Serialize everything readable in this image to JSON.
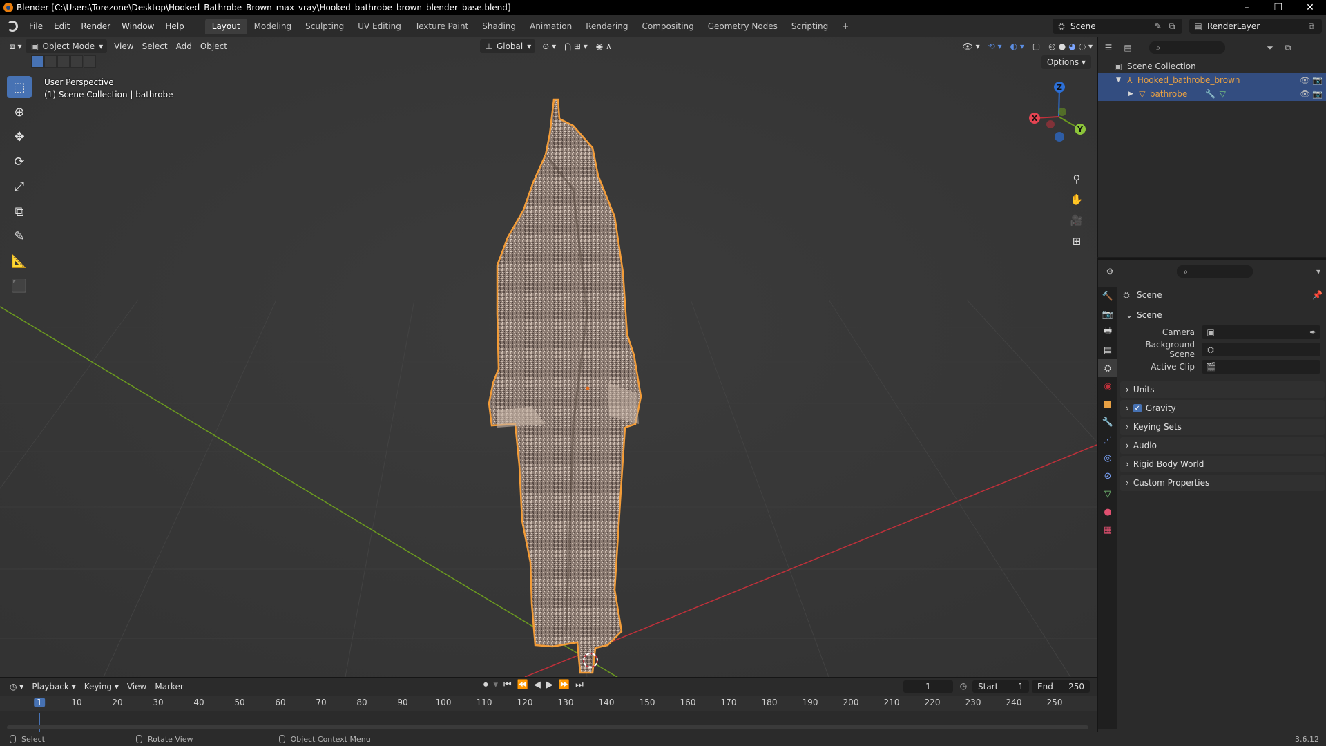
{
  "window": {
    "title": "Blender [C:\\Users\\Torezone\\Desktop\\Hooked_Bathrobe_Brown_max_vray\\Hooked_bathrobe_brown_blender_base.blend]",
    "controls": [
      "–",
      "❐",
      "✕"
    ]
  },
  "menu": [
    "File",
    "Edit",
    "Render",
    "Window",
    "Help"
  ],
  "workspaces": [
    "Layout",
    "Modeling",
    "Sculpting",
    "UV Editing",
    "Texture Paint",
    "Shading",
    "Animation",
    "Rendering",
    "Compositing",
    "Geometry Nodes",
    "Scripting"
  ],
  "active_workspace": "Layout",
  "add_workspace": "+",
  "scene_selector": {
    "scene": "Scene",
    "view_layer": "RenderLayer"
  },
  "viewport": {
    "mode": "Object Mode",
    "menus": [
      "View",
      "Select",
      "Add",
      "Object"
    ],
    "orientation": "Global",
    "info_line1": "User Perspective",
    "info_line2": "(1) Scene Collection | bathrobe",
    "options_label": "Options",
    "gizmo_axes": {
      "x": "X",
      "y": "Y",
      "z": "Z"
    }
  },
  "outliner": {
    "root": "Scene Collection",
    "items": [
      {
        "label": "Hooked_bathrobe_brown",
        "type": "empty"
      },
      {
        "label": "bathrobe",
        "type": "mesh"
      }
    ]
  },
  "properties": {
    "context_title": "Scene",
    "scene_panel": "Scene",
    "fields": [
      {
        "label": "Camera",
        "value": ""
      },
      {
        "label": "Background Scene",
        "value": ""
      },
      {
        "label": "Active Clip",
        "value": ""
      }
    ],
    "collapsed_panels": [
      "Units",
      "Gravity",
      "Keying Sets",
      "Audio",
      "Rigid Body World",
      "Custom Properties"
    ],
    "gravity_enabled": true
  },
  "timeline": {
    "menus": [
      "Playback",
      "Keying",
      "View",
      "Marker"
    ],
    "current_frame": "1",
    "start_label": "Start",
    "start": "1",
    "end_label": "End",
    "end": "250",
    "ticks": [
      "10",
      "20",
      "30",
      "40",
      "50",
      "60",
      "70",
      "80",
      "90",
      "100",
      "110",
      "120",
      "130",
      "140",
      "150",
      "160",
      "170",
      "180",
      "190",
      "200",
      "210",
      "220",
      "230",
      "240",
      "250"
    ]
  },
  "statusbar": {
    "items": [
      "Select",
      "Rotate View",
      "Object Context Menu"
    ],
    "version": "3.6.12"
  },
  "colors": {
    "selection": "#4772b3",
    "object_outline": "#f39c38",
    "x_axis": "#c0303a",
    "y_axis": "#6b9a1f",
    "z_axis": "#2c6fd6",
    "outliner_object_text": "#e8a043"
  }
}
